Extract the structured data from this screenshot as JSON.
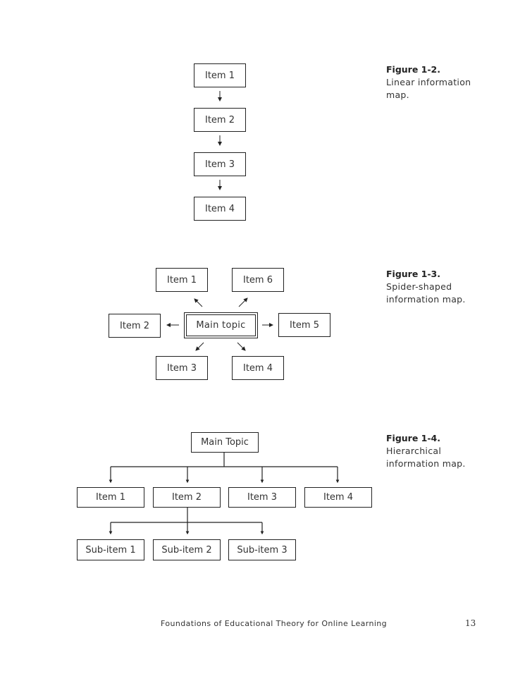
{
  "figures": {
    "linear": {
      "caption_label": "Figure 1-2.",
      "caption_text": "Linear information map.",
      "caption_line1": "Linear information",
      "caption_line2": "map.",
      "items": [
        "Item 1",
        "Item 2",
        "Item 3",
        "Item 4"
      ]
    },
    "spider": {
      "caption_label": "Figure 1-3.",
      "caption_line1": "Spider-shaped",
      "caption_line2": "information map.",
      "center": "Main topic",
      "items": [
        "Item 1",
        "Item 2",
        "Item 3",
        "Item 4",
        "Item 5",
        "Item 6"
      ]
    },
    "hierarchical": {
      "caption_label": "Figure 1-4.",
      "caption_line1": "Hierarchical",
      "caption_line2": "information map.",
      "root": "Main Topic",
      "items": [
        "Item 1",
        "Item 2",
        "Item 3",
        "Item 4"
      ],
      "subitems": [
        "Sub-item 1",
        "Sub-item 2",
        "Sub-item 3"
      ]
    }
  },
  "footer": {
    "book_title": "Foundations of Educational Theory for Online Learning",
    "page_number": "13"
  }
}
